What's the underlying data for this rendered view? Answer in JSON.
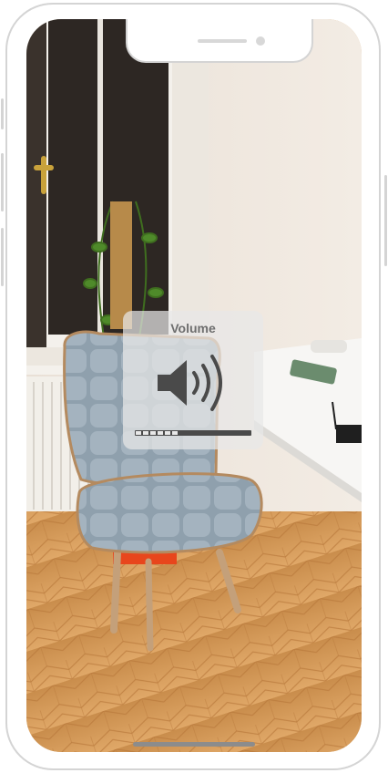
{
  "volume_hud": {
    "title": "Volume",
    "icon": "speaker-volume-icon",
    "level_segments_filled": 6,
    "level_segments_total": 16
  },
  "colors": {
    "hud_background": "#e8e8e8",
    "hud_title": "#6e6e6e",
    "hud_icon": "#4a4a4a",
    "phone_frame": "#d4d4d4",
    "home_indicator": "#8c8c8c"
  }
}
